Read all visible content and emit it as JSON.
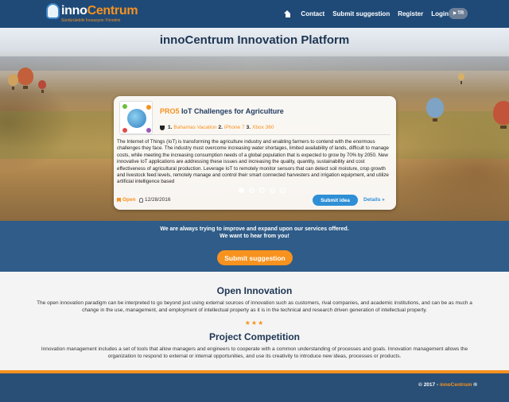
{
  "brand": {
    "name_part1": "inno",
    "name_part2": "Centrum",
    "tagline": "Sürdürülebilir İnovasyon Yönetimi"
  },
  "nav": {
    "contact": "Contact",
    "submit": "Submit suggestion",
    "register": "Register",
    "login": "Login",
    "lang": "TR"
  },
  "hero": {
    "title": "innoCentrum Innovation Platform",
    "card": {
      "code": "PRO5",
      "title": "IoT Challenges for Agriculture",
      "rewards": [
        {
          "rank": "1.",
          "name": "Bahamas Vacation"
        },
        {
          "rank": "2.",
          "name": "iPhone 7"
        },
        {
          "rank": "3.",
          "name": "Xbox 360"
        }
      ],
      "description": "The Internet of Things (IoT) is transforming the agriculture industry and enabling farmers to contend with the enormous challenges they face. The industry must overcome increasing water shortages, limited availability of lands, difficult to manage costs, while meeting the increasing consumption needs of a global population that is expected to grow by 70% by 2050. New innovative IoT applications are addressing these issues and increasing the quality, quantity, sustainability and cost effectiveness of agricultural production. Leverage IoT to remotely monitor sensors that can detect soil moisture, crop growth and livestock feed levels, remotely manage and control their smart connected harvesters and irrigation equipment, and utilize artificial intelligence based",
      "status": "Open",
      "date": "12/28/2016",
      "submit_label": "Submit idea",
      "details_label": "Details »"
    },
    "active_slide": 1
  },
  "strip": {
    "line1": "We are always trying to improve and expand upon our services offered.",
    "line2": "We want to hear from you!",
    "button": "Submit suggestion"
  },
  "open_innovation": {
    "title": "Open Innovation",
    "text": "The open innovation paradigm can be interpreted to go beyond just using external sources of innovation such as customers, rival companies, and academic institutions, and can be as much a change in the use, management, and employment of intellectual property as it is in the technical and research driven generation of intellectual property."
  },
  "stars": "★★★",
  "project_competition": {
    "title": "Project Competition",
    "text": "Innovation management includes a set of tools that allow managers and engineers to cooperate with a common understanding of processes and goals. Innovation management allows the organization to respond to external or internal opportunities, and use its creativity to introduce new ideas, processes or products."
  },
  "footer": {
    "prefix": "© 2017 - ",
    "brand1": "inno",
    "brand2": "Centrum",
    "suffix": " ®"
  },
  "colors": {
    "navy": "#1f4a78",
    "orange": "#f7921e",
    "blue": "#2f8fd6"
  }
}
